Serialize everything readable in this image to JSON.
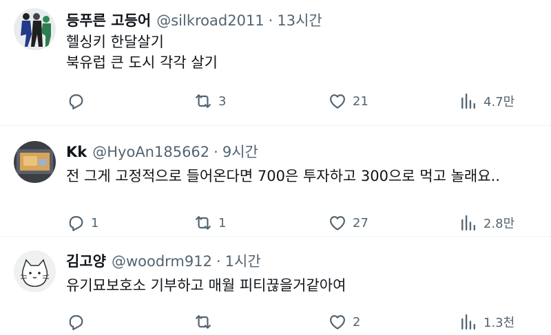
{
  "tweets": [
    {
      "name": "등푸른 고등어",
      "handle": "@silkroad2011",
      "separator": "·",
      "time": "13시간",
      "lines": [
        "헬싱키 한달살기",
        "북유럽 큰 도시 각각 살기"
      ],
      "reply_count": "",
      "retweet_count": "3",
      "like_count": "21",
      "view_count": "4.7만"
    },
    {
      "name": "Kk",
      "handle": "@HyoAn185662",
      "separator": "·",
      "time": "9시간",
      "lines": [
        "전 그게 고정적으로 들어온다면 700은 투자하고 300으로 먹고 놀래요.."
      ],
      "reply_count": "1",
      "retweet_count": "1",
      "like_count": "27",
      "view_count": "2.8만"
    },
    {
      "name": "김고양",
      "handle": "@woodrm912",
      "separator": "·",
      "time": "1시간",
      "lines": [
        "유기묘보호소 기부하고 매월 피티끊을거같아여"
      ],
      "reply_count": "",
      "retweet_count": "",
      "like_count": "2",
      "view_count": "1.3천"
    }
  ],
  "colors": {
    "text": "#0f1419",
    "secondary": "#536471",
    "divider": "#eff3f4"
  },
  "icons": [
    "reply-icon",
    "retweet-icon",
    "like-icon",
    "views-icon"
  ]
}
